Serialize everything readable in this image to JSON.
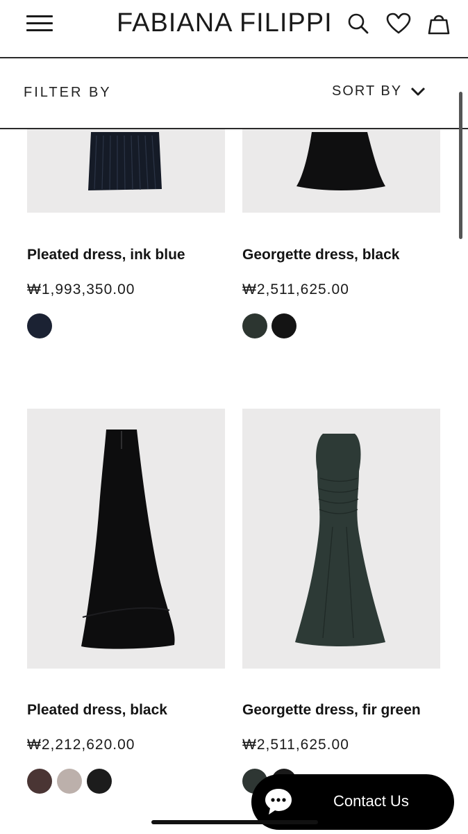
{
  "header": {
    "brand": "FABIANA FILIPPI",
    "icons": [
      "menu-icon",
      "search-icon",
      "heart-icon",
      "bag-icon"
    ]
  },
  "toolbar": {
    "filter_label": "FILTER BY",
    "sort_label": "SORT BY"
  },
  "products": [
    {
      "name": "Pleated dress, ink blue",
      "price": "₩1,993,350.00",
      "swatches": [
        "#1b2233"
      ]
    },
    {
      "name": "Georgette dress, black",
      "price": "₩2,511,625.00",
      "swatches": [
        "#2c3530",
        "#141414"
      ]
    },
    {
      "name": "Pleated dress, black",
      "price": "₩2,212,620.00",
      "swatches": [
        "#4a3534",
        "#bcb0ab",
        "#1c1c1c"
      ]
    },
    {
      "name": "Georgette dress, fir green",
      "price": "₩2,511,625.00",
      "swatches": [
        "#2e3633",
        "#1a1a1a"
      ]
    }
  ],
  "contact": {
    "label": "Contact Us"
  },
  "colors": {
    "image_bg": "#ebeaea",
    "button_bg": "#000000"
  }
}
